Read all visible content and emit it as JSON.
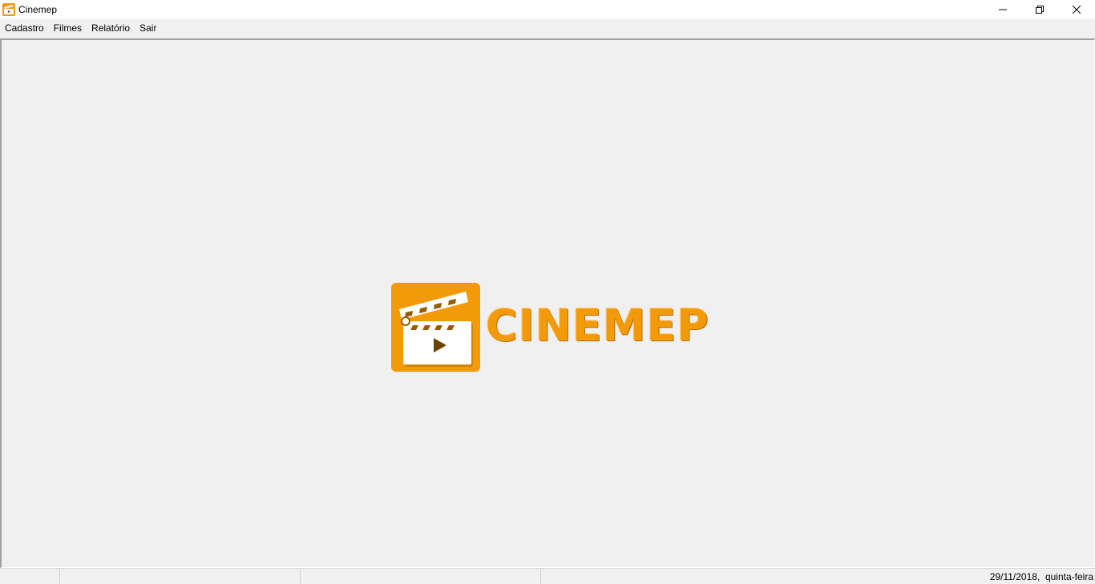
{
  "window": {
    "title": "Cinemep",
    "icon": "clapperboard-icon",
    "controls": [
      "minimize-icon",
      "restore-icon",
      "close-icon"
    ]
  },
  "menu": {
    "items": [
      {
        "label": "Cadastro"
      },
      {
        "label": "Filmes"
      },
      {
        "label": "Relatório"
      },
      {
        "label": "Sair"
      }
    ]
  },
  "logo": {
    "text": "CINEMEP",
    "icon": "clapperboard-play-icon",
    "color": "#f39a0a"
  },
  "statusbar": {
    "panels": [
      "",
      "",
      ""
    ],
    "date": "29/11/2018,  quinta-feira"
  },
  "colors": {
    "accent": "#f39a0a",
    "accent_dark": "#9a5b00",
    "background": "#f0f0f0"
  }
}
